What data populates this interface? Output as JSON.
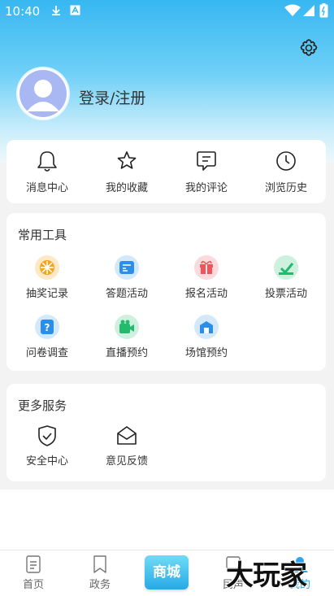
{
  "status_bar": {
    "time": "10:40"
  },
  "profile": {
    "login_label": "登录/注册"
  },
  "quick_actions": [
    {
      "label": "消息中心",
      "icon": "bell-icon"
    },
    {
      "label": "我的收藏",
      "icon": "star-icon"
    },
    {
      "label": "我的评论",
      "icon": "comment-icon"
    },
    {
      "label": "浏览历史",
      "icon": "clock-icon"
    }
  ],
  "tools": {
    "title": "常用工具",
    "items": [
      {
        "label": "抽奖记录",
        "icon": "lottery-icon",
        "color": "#f7a31c"
      },
      {
        "label": "答题活动",
        "icon": "quiz-icon",
        "color": "#2b8ee8"
      },
      {
        "label": "报名活动",
        "icon": "gift-icon",
        "color": "#f2545b"
      },
      {
        "label": "投票活动",
        "icon": "vote-icon",
        "color": "#22bb6e"
      },
      {
        "label": "问卷调查",
        "icon": "survey-icon",
        "color": "#2b8ee8"
      },
      {
        "label": "直播预约",
        "icon": "live-icon",
        "color": "#22bb6e"
      },
      {
        "label": "场馆预约",
        "icon": "venue-icon",
        "color": "#2b8ee8"
      }
    ]
  },
  "more_services": {
    "title": "更多服务",
    "items": [
      {
        "label": "安全中心",
        "icon": "shield-icon"
      },
      {
        "label": "意见反馈",
        "icon": "envelope-icon"
      }
    ]
  },
  "tab_bar": {
    "items": [
      {
        "label": "首页",
        "icon": "home-doc-icon"
      },
      {
        "label": "政务",
        "icon": "bookmark-icon"
      },
      {
        "label": "商城",
        "icon": "mall-badge"
      },
      {
        "label": "民声",
        "icon": "voice-icon"
      },
      {
        "label": "我的",
        "icon": "user-icon"
      }
    ],
    "active": "我的"
  },
  "watermark": {
    "text": "大玩家"
  },
  "colors": {
    "accent": "#2aa3f0",
    "hero_top": "#37b7f1"
  }
}
